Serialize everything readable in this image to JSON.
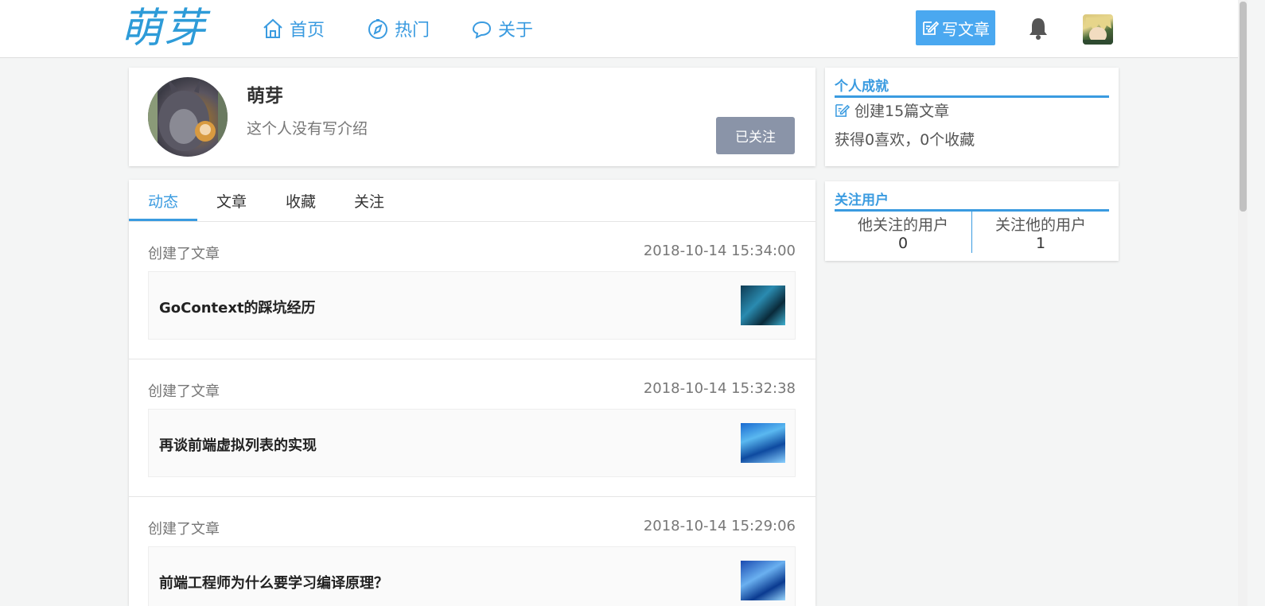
{
  "header": {
    "logo": "萌芽",
    "nav": [
      {
        "label": "首页",
        "icon": "home-icon"
      },
      {
        "label": "热门",
        "icon": "compass-icon"
      },
      {
        "label": "关于",
        "icon": "chat-icon"
      }
    ],
    "write_button": "写文章",
    "accent_color": "#3a9be0"
  },
  "profile": {
    "name": "萌芽",
    "intro": "这个人没有写介绍",
    "follow_button": "已关注"
  },
  "achievements": {
    "title": "个人成就",
    "articles": "创建15篇文章",
    "stats": "获得0喜欢，0个收藏"
  },
  "follows": {
    "title": "关注用户",
    "following_label": "他关注的用户",
    "following_count": "0",
    "followers_label": "关注他的用户",
    "followers_count": "1"
  },
  "tabs": [
    "动态",
    "文章",
    "收藏",
    "关注"
  ],
  "feed": [
    {
      "action": "创建了文章",
      "time": "2018-10-14 15:34:00",
      "title": "GoContext的踩坑经历"
    },
    {
      "action": "创建了文章",
      "time": "2018-10-14 15:32:38",
      "title": "再谈前端虚拟列表的实现"
    },
    {
      "action": "创建了文章",
      "time": "2018-10-14 15:29:06",
      "title": "前端工程师为什么要学习编译原理？"
    }
  ]
}
